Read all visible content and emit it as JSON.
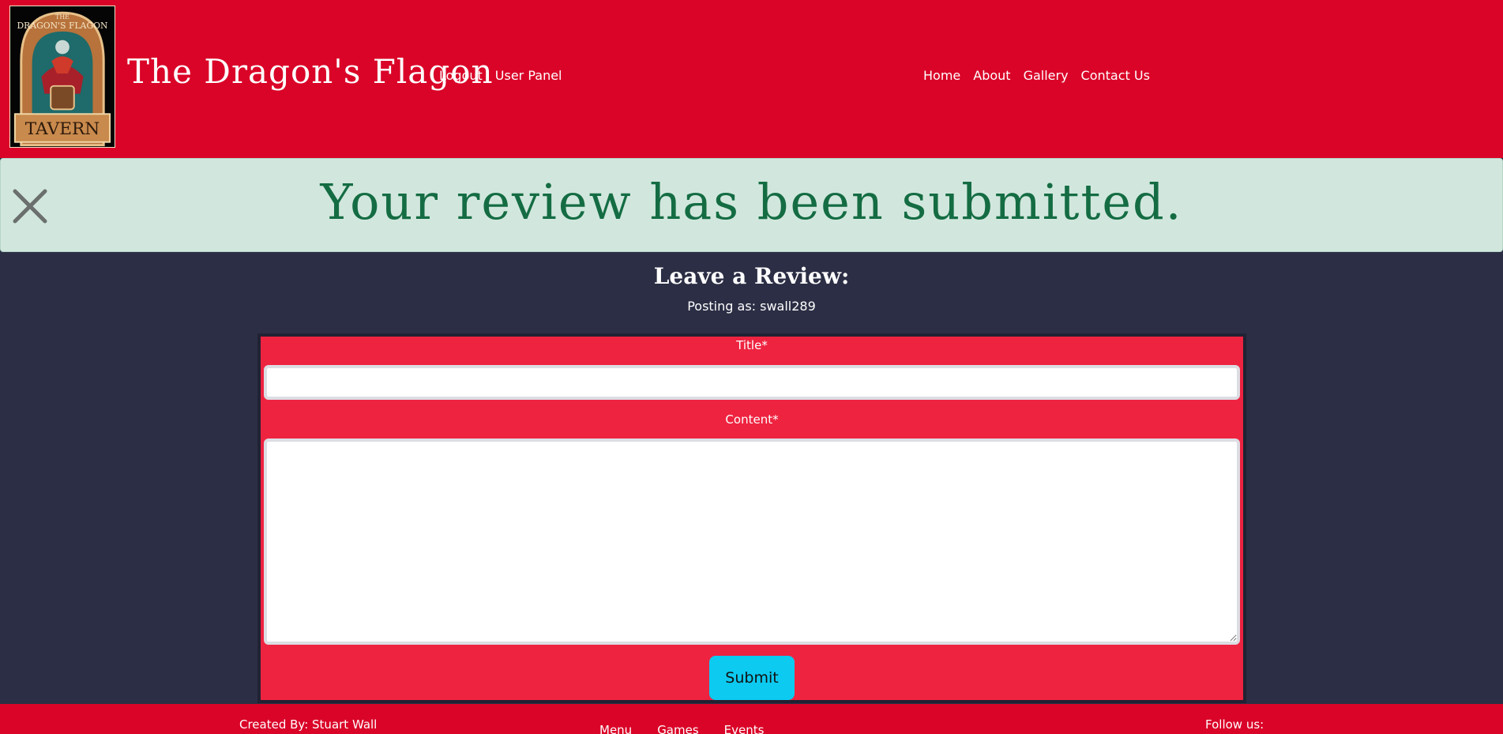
{
  "header": {
    "logo": {
      "top_text": "THE",
      "arch_text": "DRAGON'S FLAGON",
      "banner_text": "TAVERN"
    },
    "brand": "The Dragon's Flagon",
    "user_nav": [
      "Logout",
      "User Panel"
    ],
    "main_nav": [
      "Home",
      "About",
      "Gallery",
      "Contact Us"
    ]
  },
  "alert": {
    "message": "Your review has been submitted.",
    "close_icon": "close-icon"
  },
  "review_form": {
    "heading": "Leave a Review:",
    "posting_as": "Posting as: swall289",
    "title_label": "Title*",
    "title_value": "",
    "content_label": "Content*",
    "content_value": "",
    "submit_label": "Submit"
  },
  "footer": {
    "credit": "Created By: Stuart Wall",
    "links": [
      "Menu",
      "Games",
      "Events"
    ],
    "follow": "Follow us:"
  },
  "colors": {
    "header_red": "#da0428",
    "form_red": "#ee2340",
    "page_bg": "#2b2e44",
    "alert_bg": "#d1e7dd",
    "alert_text": "#146c43",
    "submit_bg": "#0dcaf0"
  }
}
